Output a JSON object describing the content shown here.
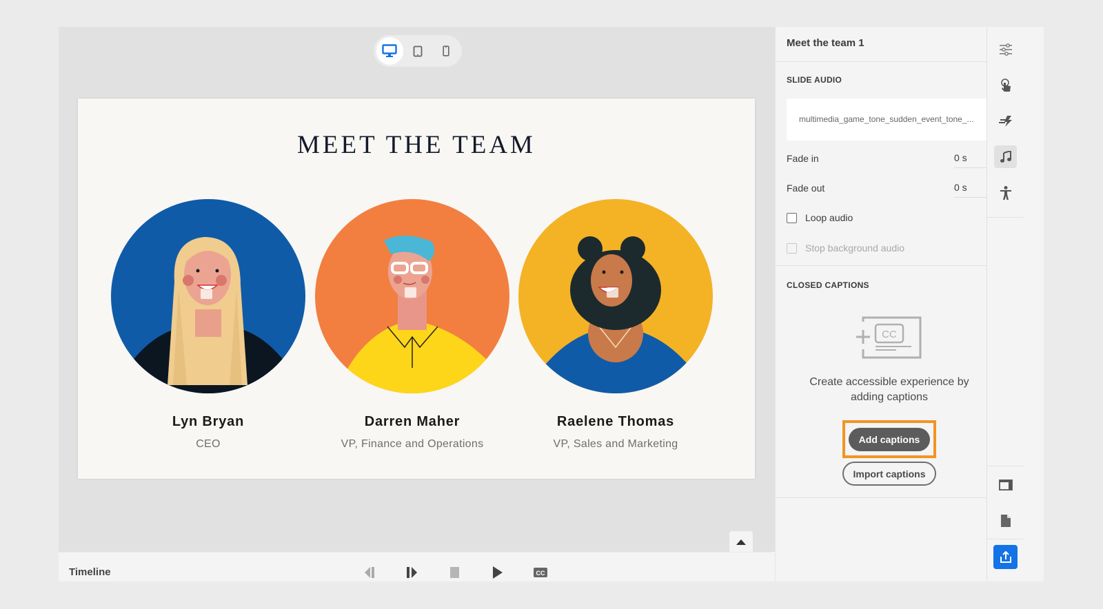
{
  "device_switcher": {
    "options": [
      {
        "name": "desktop",
        "icon": "desktop-icon",
        "active": true
      },
      {
        "name": "tablet",
        "icon": "tablet-icon",
        "active": false
      },
      {
        "name": "mobile",
        "icon": "mobile-icon",
        "active": false
      }
    ]
  },
  "slide": {
    "title": "MEET THE TEAM",
    "members": [
      {
        "name": "Lyn Bryan",
        "role": "CEO",
        "bg_color": "#0f5ba8"
      },
      {
        "name": "Darren Maher",
        "role": "VP, Finance and Operations",
        "bg_color": "#f27f40"
      },
      {
        "name": "Raelene Thomas",
        "role": "VP, Sales and Marketing",
        "bg_color": "#f4b225"
      }
    ]
  },
  "timeline": {
    "label": "Timeline",
    "controls": [
      "previous-icon",
      "next-icon",
      "stop-icon",
      "play-icon",
      "closed-captions-icon"
    ]
  },
  "panel": {
    "title": "Meet the team 1",
    "slide_audio": {
      "heading": "SLIDE AUDIO",
      "file": "multimedia_game_tone_sudden_event_tone_...",
      "fade_in_label": "Fade in",
      "fade_in_value": "0 s",
      "fade_out_label": "Fade out",
      "fade_out_value": "0 s",
      "loop_label": "Loop audio",
      "loop_checked": false,
      "stop_bg_label": "Stop background audio",
      "stop_bg_checked": false,
      "stop_bg_disabled": true
    },
    "closed_captions": {
      "heading": "CLOSED CAPTIONS",
      "description": "Create accessible experience by adding captions",
      "add_label": "Add captions",
      "import_label": "Import captions",
      "highlight_color": "#f29423"
    }
  },
  "rail": {
    "top_icons": [
      "properties-icon",
      "interaction-icon",
      "animation-icon",
      "audio-icon",
      "accessibility-icon"
    ],
    "active": "audio-icon",
    "bottom_icons": [
      "slide-layout-icon",
      "document-icon",
      "publish-icon"
    ],
    "publish_color": "#1473e6"
  }
}
